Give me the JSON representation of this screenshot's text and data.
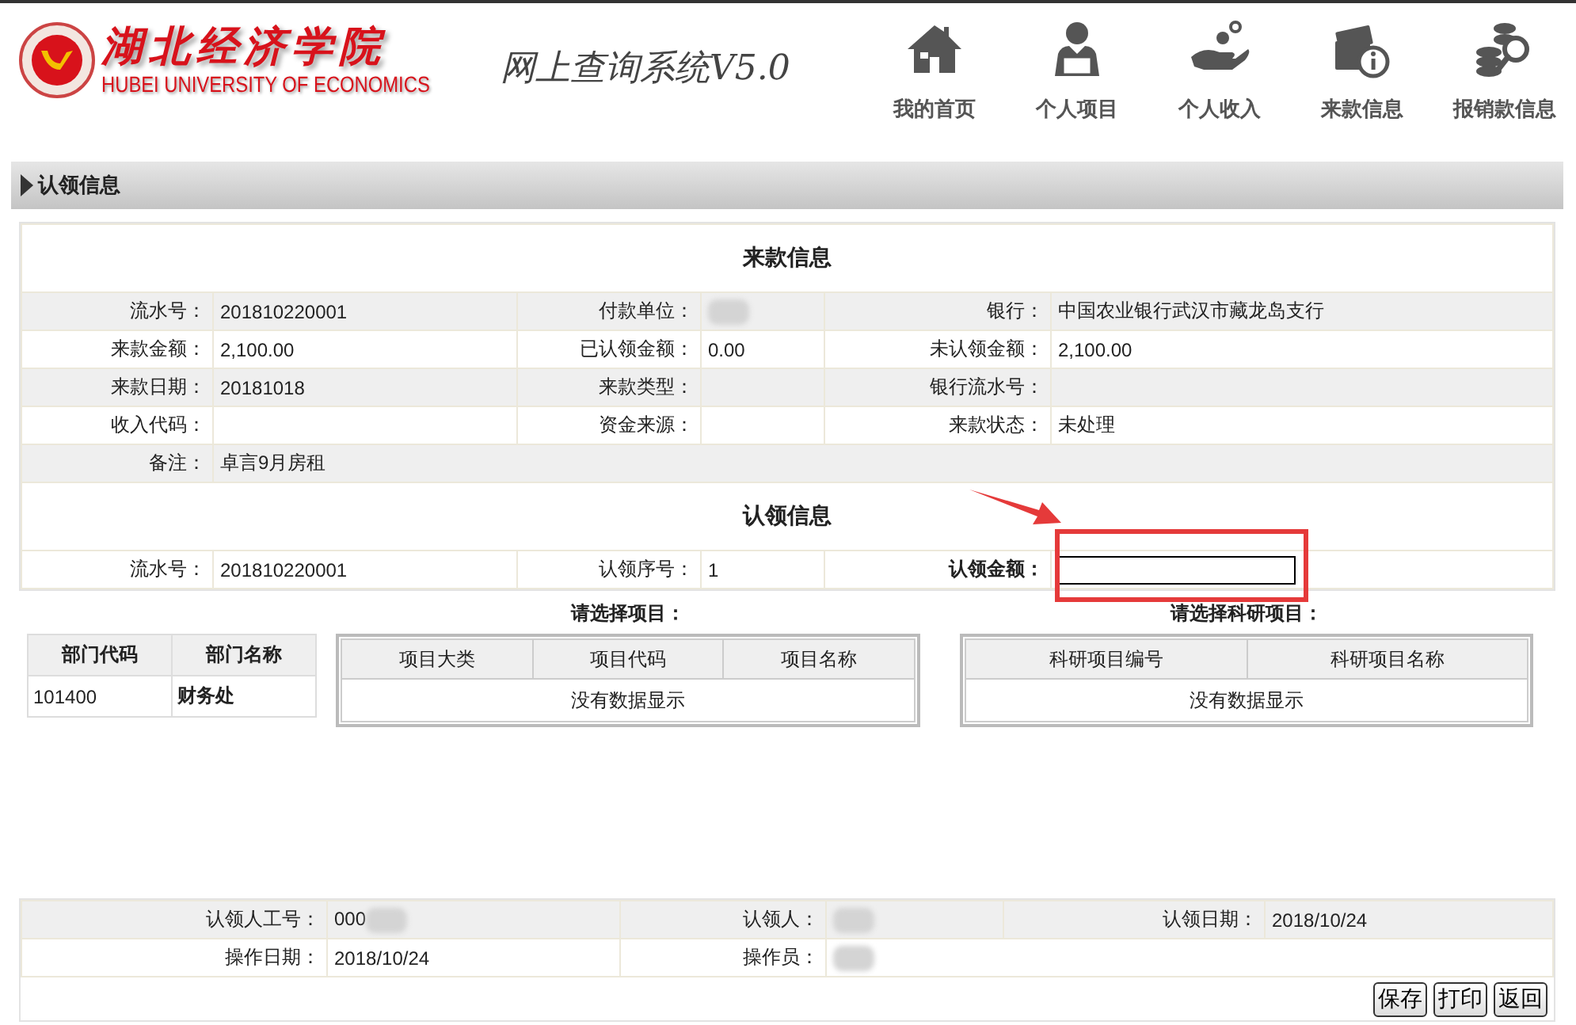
{
  "header": {
    "logo_name": "湖北经济学院",
    "logo_english": "HUBEI UNIVERSITY OF ECONOMICS",
    "system_title": "网上查询系统V5.0"
  },
  "nav": [
    {
      "label": "我的首页"
    },
    {
      "label": "个人项目"
    },
    {
      "label": "个人收入"
    },
    {
      "label": "来款信息"
    },
    {
      "label": "报销款信息"
    }
  ],
  "section_title": "认领信息",
  "payment_info": {
    "title": "来款信息",
    "rows": [
      [
        {
          "label": "流水号：",
          "value": "201810220001"
        },
        {
          "label": "付款单位：",
          "redacted": true
        },
        {
          "label": "银行：",
          "value": "中国农业银行武汉市藏龙岛支行"
        }
      ],
      [
        {
          "label": "来款金额：",
          "value": "2,100.00"
        },
        {
          "label": "已认领金额：",
          "value": "0.00"
        },
        {
          "label": "未认领金额：",
          "value": "2,100.00"
        }
      ],
      [
        {
          "label": "来款日期：",
          "value": "20181018"
        },
        {
          "label": "来款类型："
        },
        {
          "label": "银行流水号："
        }
      ],
      [
        {
          "label": "收入代码："
        },
        {
          "label": "资金来源："
        },
        {
          "label": "来款状态：",
          "value": "未处理"
        }
      ],
      [
        {
          "label": "备注：",
          "value": "卓言9月房租"
        }
      ]
    ]
  },
  "claim_info": {
    "title": "认领信息",
    "rows": [
      [
        {
          "label": "流水号：",
          "value": "201810220001"
        },
        {
          "label": "认领序号：",
          "value": "1"
        },
        {
          "label": "认领金额：",
          "kind": "input",
          "highlighted": true
        }
      ]
    ]
  },
  "department_table": {
    "columns": [
      "部门代码",
      "部门名称"
    ],
    "rows": [
      [
        "101400",
        "财务处"
      ]
    ]
  },
  "project_table": {
    "title": "请选择项目：",
    "columns": [
      "项目大类",
      "项目代码",
      "项目名称"
    ],
    "empty_text": "没有数据显示"
  },
  "research_table": {
    "title": "请选择科研项目：",
    "columns": [
      "科研项目编号",
      "科研项目名称"
    ],
    "empty_text": "没有数据显示"
  },
  "footer": {
    "rows": [
      [
        {
          "label": "认领人工号：",
          "value": "000",
          "redacted": true
        },
        {
          "label": "认领人：",
          "redacted": true
        },
        {
          "label": "认领日期：",
          "value": "2018/10/24"
        }
      ],
      [
        {
          "label": "操作日期：",
          "value": "2018/10/24"
        },
        {
          "label": "操作员：",
          "redacted": true
        }
      ]
    ],
    "buttons": [
      "保存",
      "打印",
      "返回"
    ]
  }
}
